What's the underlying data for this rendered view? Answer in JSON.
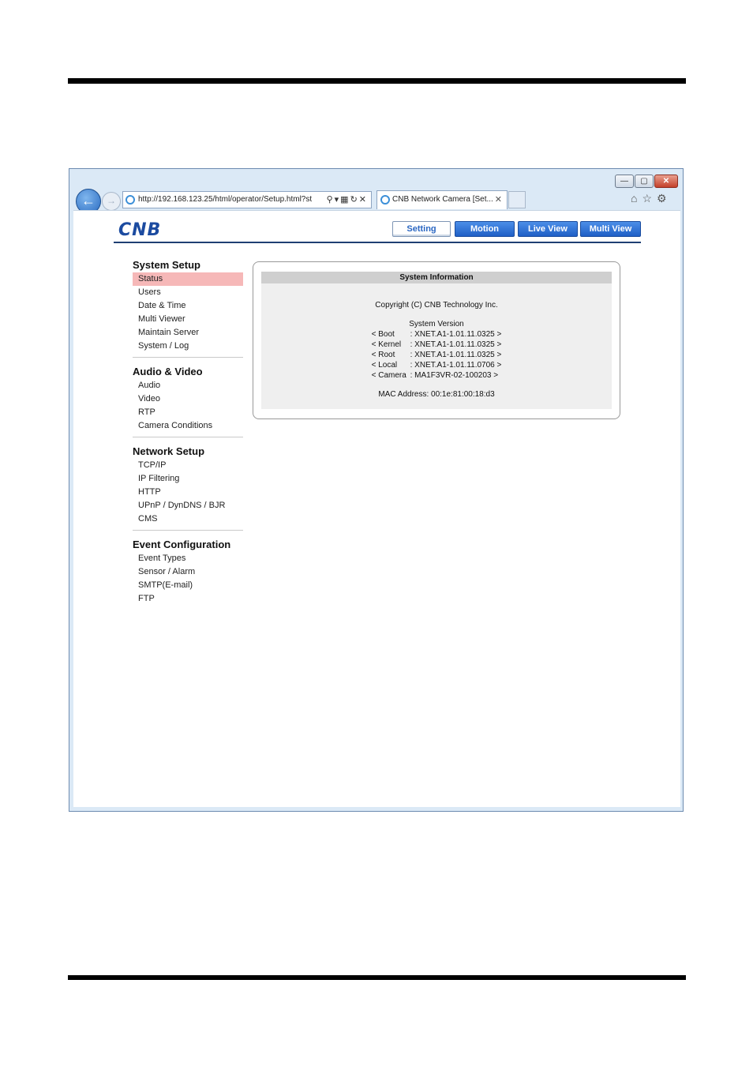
{
  "browser": {
    "address": "http://192.168.123.25/html/operator/Setup.html?st",
    "tab_title": "CNB Network Camera [Set...",
    "window_controls": {
      "minimize": "—",
      "restore": "▢",
      "close": "✕"
    }
  },
  "brand": {
    "logo": "CNB",
    "color": "#1c4ba0"
  },
  "top_nav": [
    {
      "label": "Setting",
      "selected": true
    },
    {
      "label": "Motion",
      "selected": false
    },
    {
      "label": "Live View",
      "selected": false
    },
    {
      "label": "Multi View",
      "selected": false
    }
  ],
  "sidebar": {
    "system_setup": {
      "title": "System Setup",
      "items": [
        "Status",
        "Users",
        "Date & Time",
        "Multi Viewer",
        "Maintain Server",
        "System / Log"
      ]
    },
    "audio_video": {
      "title": "Audio & Video",
      "items": [
        "Audio",
        "Video",
        "RTP",
        "Camera Conditions"
      ]
    },
    "network_setup": {
      "title": "Network Setup",
      "items": [
        "TCP/IP",
        "IP Filtering",
        "HTTP",
        "UPnP / DynDNS / BJR",
        "CMS"
      ]
    },
    "event_configuration": {
      "title": "Event Configuration",
      "items": [
        "Event Types",
        "Sensor / Alarm",
        "SMTP(E-mail)",
        "FTP"
      ]
    },
    "active_item": "Status"
  },
  "system_info": {
    "title": "System Information",
    "copyright": "Copyright (C) CNB Technology Inc.",
    "version_title": "System Version",
    "versions": [
      {
        "key": "< Boot",
        "value": ": XNET.A1-1.01.11.0325 >"
      },
      {
        "key": "< Kernel",
        "value": ": XNET.A1-1.01.11.0325 >"
      },
      {
        "key": "< Root",
        "value": ": XNET.A1-1.01.11.0325 >"
      },
      {
        "key": "< Local",
        "value": ": XNET.A1-1.01.11.0706 >"
      },
      {
        "key": "< Camera",
        "value": ": MA1F3VR-02-100203 >"
      }
    ],
    "mac": "MAC Address: 00:1e:81:00:18:d3"
  }
}
